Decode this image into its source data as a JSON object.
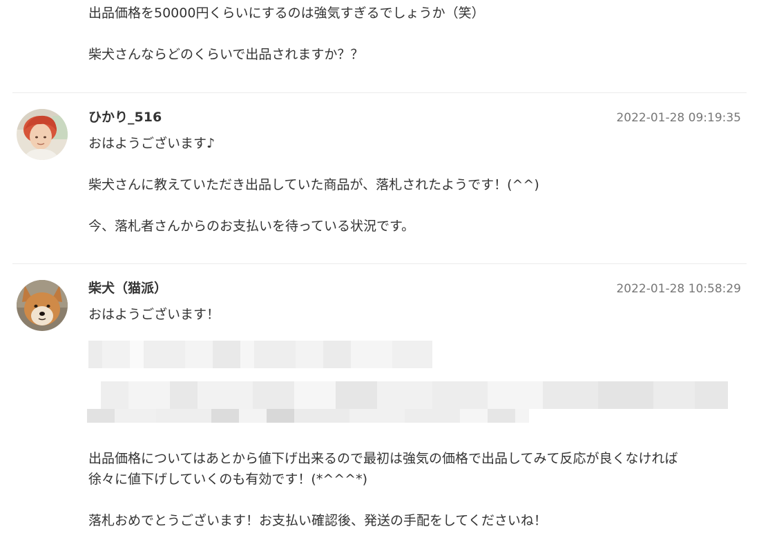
{
  "top_comment": {
    "line1": "出品価格を50000円くらいにするのは強気すぎるでしょうか（笑）",
    "line2": "柴犬さんならどのくらいで出品されますか？？"
  },
  "comments": [
    {
      "author": "ひかり_516",
      "timestamp": "2022-01-28 09:19:35",
      "lines": [
        "おはようございます♪",
        "柴犬さんに教えていただき出品していた商品が、落札されたようです！(^^)",
        "今、落札者さんからのお支払いを待っている状況です。"
      ]
    },
    {
      "author": "柴犬（猫派）",
      "timestamp": "2022-01-28 10:58:29",
      "lines": [
        "おはようございます！",
        "出品価格についてはあとから値下げ出来るので最初は強気の価格で出品してみて反応が良くなければ",
        "徐々に値下げしていくのも有効です！(*^^^*)",
        "落札おめでとうございます！お支払い確認後、発送の手配をしてくださいね！"
      ]
    }
  ],
  "colors": {
    "text": "#333333",
    "timestamp": "#777777",
    "divider": "#ebebeb"
  }
}
